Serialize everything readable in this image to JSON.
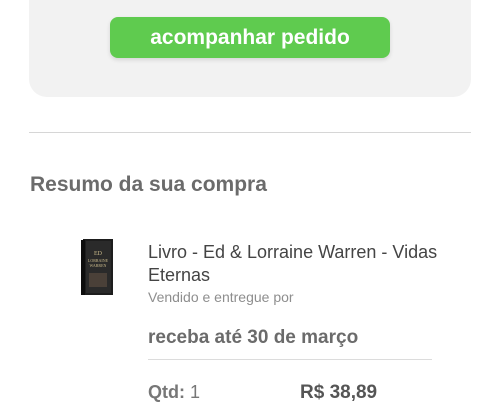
{
  "order": {
    "track_button_label": "acompanhar pedido"
  },
  "summary": {
    "title": "Resumo da sua compra",
    "item": {
      "name": "Livro - Ed & Lorraine Warren - Vidas Eternas",
      "seller_text": "Vendido e entregue por",
      "delivery": "receba até 30 de março",
      "qty_label": "Qtd:",
      "qty_value": "1",
      "price": "R$ 38,89",
      "cover_text": [
        "ED",
        "LORRAINE",
        "WARREN"
      ]
    }
  },
  "colors": {
    "accent": "#5fcb4f",
    "card_bg": "#f2f2f2"
  }
}
